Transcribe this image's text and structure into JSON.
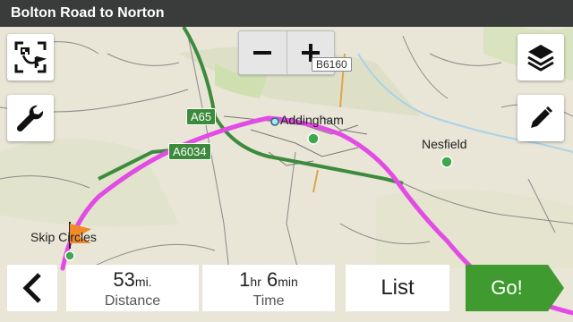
{
  "title": "Bolton Road to Norton",
  "zoom": {
    "out_label": "−",
    "in_label": "+"
  },
  "road_labels": {
    "a65": "A65",
    "a6034": "A6034",
    "b6160": "B6160"
  },
  "places": {
    "addingham": "Addingham",
    "nesfield": "Nesfield",
    "skip": "Skip Circles"
  },
  "stats": {
    "distance_value": "53",
    "distance_unit": "mi.",
    "distance_label": "Distance",
    "time_hours": "1",
    "time_hours_unit": "hr",
    "time_minutes": "6",
    "time_minutes_unit": "min",
    "time_label": "Time"
  },
  "buttons": {
    "list": "List",
    "go": "Go!"
  },
  "colors": {
    "route": "#e24be4",
    "go_green": "#3f9a2f",
    "titlebar": "#3a3c3b",
    "road_green": "#3c8b3c"
  },
  "icons": {
    "route_overview": "route-overview-icon",
    "tools": "wrench-icon",
    "layers": "layers-icon",
    "edit": "pencil-icon",
    "back": "chevron-left-icon"
  }
}
